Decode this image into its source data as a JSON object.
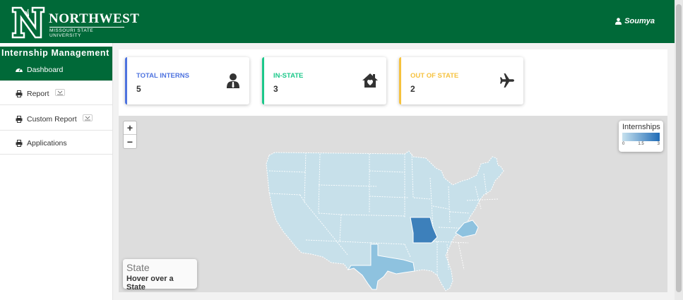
{
  "header": {
    "logo_name": "NORTHWEST",
    "logo_sub": "MISSOURI STATE UNIVERSITY",
    "user_name": "Soumya"
  },
  "sidebar": {
    "brand": "Internship Management",
    "items": [
      {
        "label": "Dashboard",
        "icon": "dashboard-icon",
        "active": true
      },
      {
        "label": "Report",
        "icon": "print-icon",
        "has_caret": true
      },
      {
        "label": "Custom Report",
        "icon": "print-icon",
        "has_caret": true
      },
      {
        "label": "Applications",
        "icon": "print-icon"
      }
    ]
  },
  "stats": [
    {
      "label": "TOTAL INTERNS",
      "value": "5",
      "color": "#4e73df",
      "icon": "user-tie-icon"
    },
    {
      "label": "IN-STATE",
      "value": "3",
      "color": "#1cc88a",
      "icon": "house-icon"
    },
    {
      "label": "OUT OF STATE",
      "value": "2",
      "color": "#f6c23e",
      "icon": "plane-icon"
    }
  ],
  "map": {
    "zoom_in": "+",
    "zoom_out": "−",
    "legend_title": "Internships",
    "legend_ticks": [
      "0",
      "1.5",
      "3"
    ],
    "legend_colors": [
      "#c8e2ef",
      "#1f6bb6"
    ],
    "info_title": "State",
    "info_hint": "Hover over a State",
    "highlighted_states": [
      {
        "state": "Missouri",
        "color": "#3d80bb"
      },
      {
        "state": "Texas",
        "color": "#8ec2df"
      },
      {
        "state": "Virginia",
        "color": "#8ec2df"
      }
    ],
    "default_state_color": "#c7e0ea"
  }
}
